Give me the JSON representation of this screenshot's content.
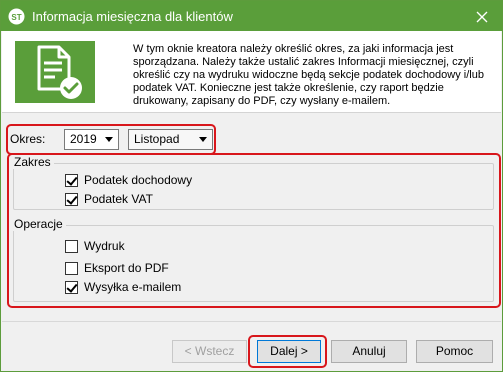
{
  "window": {
    "title": "Informacja miesięczna dla klientów",
    "accent_color": "#5a9e3a",
    "close_icon": "close-icon"
  },
  "header": {
    "icon": "document-check-icon",
    "description": "W tym oknie kreatora należy określić okres, za jaki informacja jest sporządzana. Należy także ustalić zakres Informacji miesięcznej, czyli określić czy na wydruku widoczne będą sekcje podatek dochodowy i/lub podatek VAT. Konieczne jest także określenie, czy raport będzie drukowany, zapisany do PDF, czy wysłany e-mailem."
  },
  "okres": {
    "label": "Okres:",
    "year": "2019",
    "month": "Listopad"
  },
  "zakres": {
    "legend": "Zakres",
    "items": [
      {
        "label": "Podatek dochodowy",
        "checked": true
      },
      {
        "label": "Podatek VAT",
        "checked": true
      }
    ]
  },
  "operacje": {
    "legend": "Operacje",
    "items": [
      {
        "label": "Wydruk",
        "checked": false
      },
      {
        "label": "Eksport do PDF",
        "checked": false
      },
      {
        "label": "Wysyłka e-mailem",
        "checked": true
      }
    ]
  },
  "buttons": {
    "back": "< Wstecz",
    "next": "Dalej >",
    "cancel": "Anuluj",
    "help": "Pomoc"
  },
  "highlight_color": "#d8161b"
}
